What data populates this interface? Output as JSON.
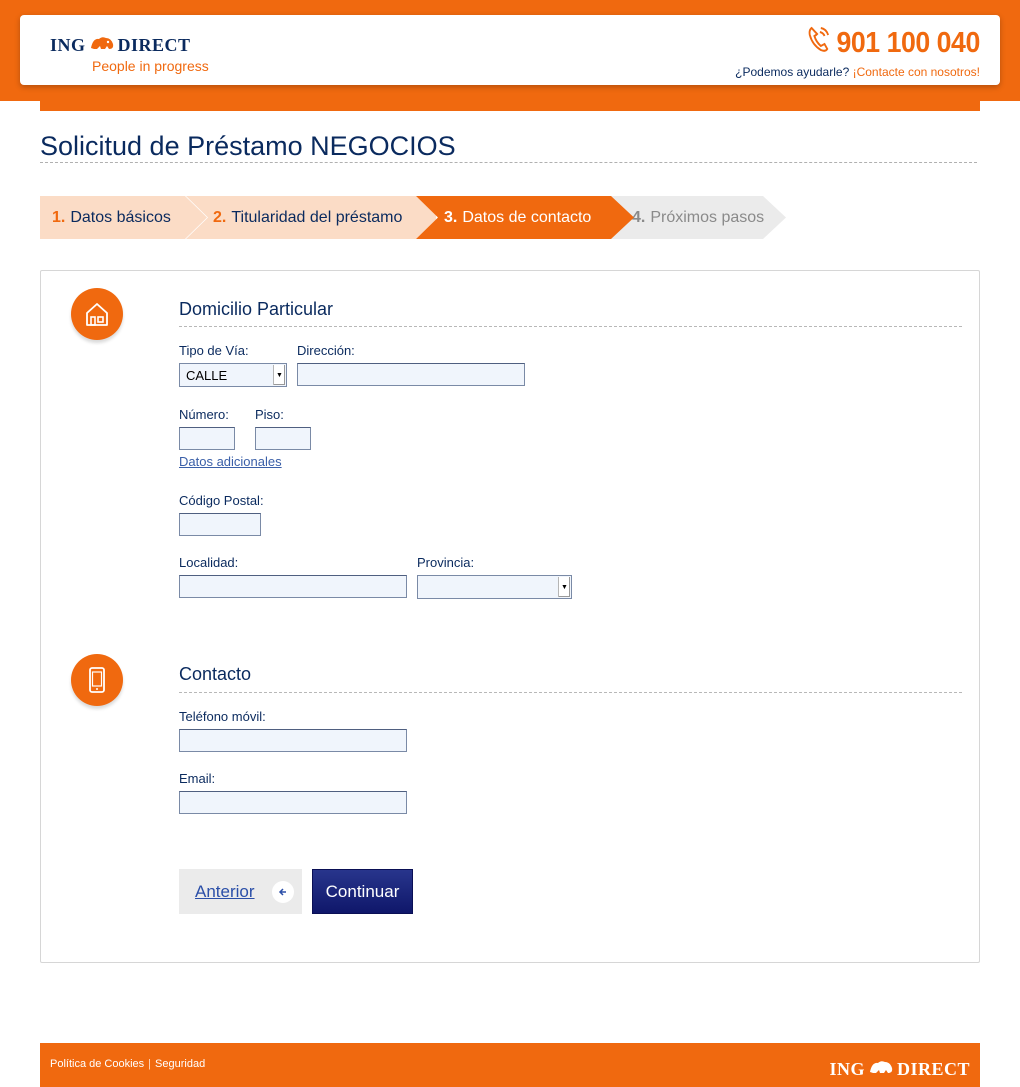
{
  "header": {
    "brand_left": "ING",
    "brand_right": "DIRECT",
    "tagline": "People in progress",
    "phone": "901 100 040",
    "help_text": "¿Podemos ayudarle?",
    "help_link": "¡Contacte con nosotros!"
  },
  "page": {
    "title": "Solicitud de Préstamo NEGOCIOS"
  },
  "steps": [
    {
      "num": "1.",
      "label": "Datos básicos",
      "state": "done"
    },
    {
      "num": "2.",
      "label": "Titularidad del préstamo",
      "state": "done"
    },
    {
      "num": "3.",
      "label": "Datos de contacto",
      "state": "active"
    },
    {
      "num": "4.",
      "label": "Próximos pasos",
      "state": "pending"
    }
  ],
  "address": {
    "section_title": "Domicilio Particular",
    "tipo_via_label": "Tipo de Vía:",
    "tipo_via_value": "CALLE",
    "direccion_label": "Dirección:",
    "direccion_value": "",
    "numero_label": "Número:",
    "numero_value": "",
    "piso_label": "Piso:",
    "piso_value": "",
    "extra_link": "Datos adicionales",
    "cp_label": "Código Postal:",
    "cp_value": "",
    "localidad_label": "Localidad:",
    "localidad_value": "",
    "provincia_label": "Provincia:",
    "provincia_value": ""
  },
  "contact": {
    "section_title": "Contacto",
    "movil_label": "Teléfono móvil:",
    "movil_value": "",
    "email_label": "Email:",
    "email_value": ""
  },
  "buttons": {
    "prev": "Anterior",
    "next": "Continuar"
  },
  "footer": {
    "cookies": "Política de Cookies",
    "security": "Seguridad",
    "brand_left": "ING",
    "brand_right": "DIRECT"
  },
  "colors": {
    "orange": "#f0690f",
    "navy": "#0a2a5e",
    "step_light": "#fbdcc6",
    "step_pending": "#ebebeb"
  },
  "icons": [
    "lion-logo-icon",
    "phone-icon",
    "house-icon",
    "mobile-phone-icon",
    "arrow-left-icon",
    "dropdown-arrow-icon"
  ]
}
